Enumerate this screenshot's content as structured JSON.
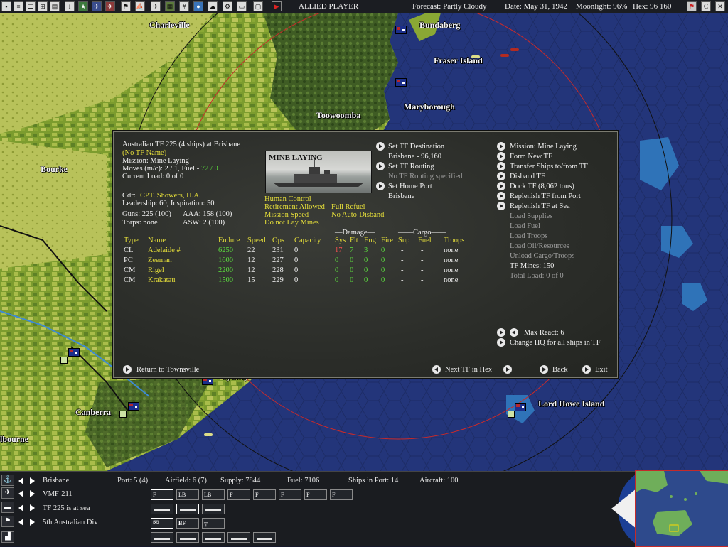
{
  "topbar": {
    "player": "ALLIED PLAYER",
    "forecast": "Forecast: Partly Cloudy",
    "date": "Date: May 31, 1942",
    "moonlight": "Moonlight: 96%",
    "hex": "Hex: 96 160",
    "icons": [
      "save-icon",
      "report-icon",
      "unit-list-icon",
      "group-icon",
      "info-icon",
      "pilot-icon",
      "aircraft-icon",
      "ship-icon",
      "flag-icon",
      "convoy-icon",
      "aircraft-icon",
      "map-icon",
      "globe-icon",
      "weather-icon",
      "options-icon",
      "scroll-icon",
      "screen-icon",
      "play-icon"
    ],
    "right_icons": [
      "map-flag-icon",
      "c-icon",
      "close-icon"
    ]
  },
  "map": {
    "labels": [
      "Charleville",
      "Bundaberg",
      "Fraser Island",
      "Maryborough",
      "Toowoomba",
      "Bourke",
      "Canberra",
      "Sydney",
      "Lord Howe Island",
      "lbourne"
    ],
    "land_color": "#8ea63a",
    "sea_color": "#23357a"
  },
  "dialog": {
    "tf_header": "Australian TF 225 (4 ships) at Brisbane",
    "tf_name": "(No TF Name)",
    "mission": "Mission: Mine Laying",
    "moves_label": "Moves (m/c): 2 / 1, Fuel - ",
    "moves_fuel": "72 / 0",
    "current_load": "Current Load: 0 of 0",
    "cdr_label": "Cdr:",
    "cdr_name": "CPT. Showers, H.A.",
    "leadership": "Leadership: 60, Inspiration: 50",
    "guns": "Guns: 225 (100)",
    "aaa": "AAA: 158 (100)",
    "torps": "Torps: none",
    "asw": "ASW: 2 (100)",
    "photo_title": "MINE LAYING",
    "flags": {
      "human_control": "Human Control",
      "retirement": "Retirement Allowed",
      "mission_speed": "Mission Speed",
      "mines": "Do not Lay Mines",
      "refuel": "Full Refuel",
      "auto_disband": "No Auto-Disband"
    },
    "mid": {
      "set_destination": "Set TF Destination",
      "destination_value": "Brisbane - 96,160",
      "set_routing": "Set TF Routing",
      "routing_value": "No TF Routing specified",
      "set_home_port": "Set Home Port",
      "home_port_value": "Brisbane"
    },
    "right_menu": {
      "mission": "Mission: Mine Laying",
      "form_new_tf": "Form New TF",
      "transfer_ships": "Transfer Ships to/from TF",
      "disband_tf": "Disband TF",
      "dock_tf": "Dock TF (8,062 tons)",
      "replenish_port": "Replenish TF from Port",
      "replenish_sea": "Replenish TF at Sea",
      "load_supplies": "Load Supplies",
      "load_fuel": "Load Fuel",
      "load_troops": "Load Troops",
      "load_oil": "Load Oil/Resources",
      "unload_cargo": "Unload Cargo/Troops",
      "tf_mines": "TF Mines: 150",
      "total_load": "Total Load: 0 of 0",
      "max_react": "Max React: 6",
      "change_hq": "Change HQ for all ships in TF"
    },
    "table": {
      "damage_group": "Damage",
      "cargo_group": "Cargo",
      "headers": [
        "Type",
        "Name",
        "Endure",
        "Speed",
        "Ops",
        "Capacity",
        "Sys",
        "Flt",
        "Eng",
        "Fire",
        "Sup",
        "Fuel",
        "Troops"
      ],
      "rows": [
        {
          "type": "CL",
          "name": "Adelaide #",
          "endure": "6250",
          "speed": "22",
          "ops": "231",
          "capacity": "0",
          "sys": "17",
          "flt": "7",
          "eng": "3",
          "fire": "0",
          "sup": "-",
          "fuel": "-",
          "troops": "none"
        },
        {
          "type": "PC",
          "name": "Zeeman",
          "endure": "1600",
          "speed": "12",
          "ops": "227",
          "capacity": "0",
          "sys": "0",
          "flt": "0",
          "eng": "0",
          "fire": "0",
          "sup": "-",
          "fuel": "-",
          "troops": "none"
        },
        {
          "type": "CM",
          "name": "Rigel",
          "endure": "2200",
          "speed": "12",
          "ops": "228",
          "capacity": "0",
          "sys": "0",
          "flt": "0",
          "eng": "0",
          "fire": "0",
          "sup": "-",
          "fuel": "-",
          "troops": "none"
        },
        {
          "type": "CM",
          "name": "Krakatau",
          "endure": "1500",
          "speed": "15",
          "ops": "229",
          "capacity": "0",
          "sys": "0",
          "flt": "0",
          "eng": "0",
          "fire": "0",
          "sup": "-",
          "fuel": "-",
          "troops": "none"
        }
      ]
    },
    "footer": {
      "return": "Return to Townsville",
      "next_tf": "Next TF in Hex",
      "back": "Back",
      "exit": "Exit"
    }
  },
  "bottom": {
    "base_name": "Brisbane",
    "port": "Port: 5 (4)",
    "airfield": "Airfield: 6 (7)",
    "supply": "Supply: 7844",
    "fuel": "Fuel: 7106",
    "ships_in_port": "Ships in Port: 14",
    "aircraft": "Aircraft: 100",
    "air_unit": "VMF-211",
    "tf_status": "TF 225 is at sea",
    "land_unit": "5th Australian Div",
    "air_slots": [
      "F",
      "LB",
      "LB",
      "F",
      "F",
      "F",
      "F",
      "F"
    ],
    "bf_label": "BF"
  }
}
